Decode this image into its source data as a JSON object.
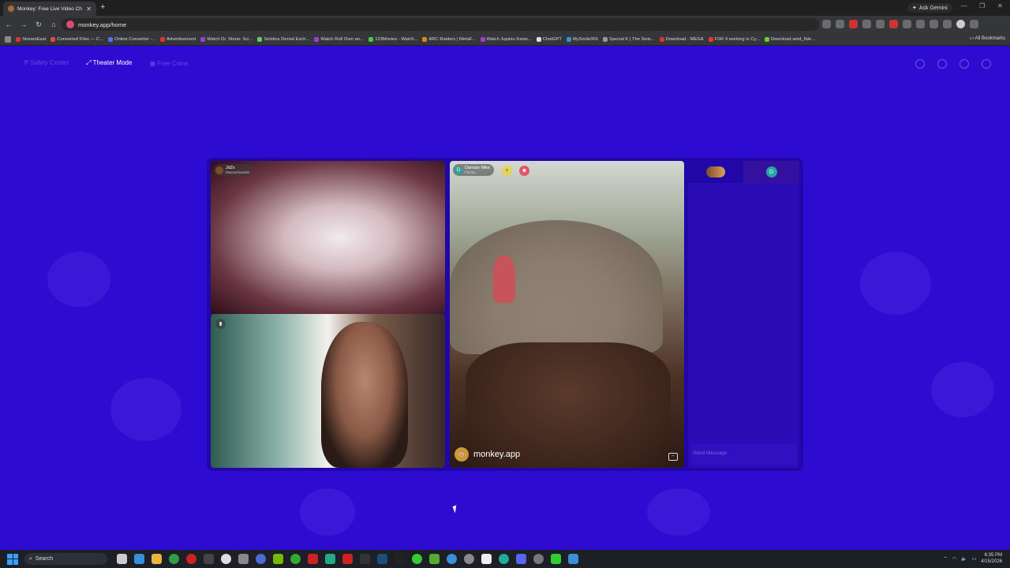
{
  "browser": {
    "tab_title": "Monkey: Free Live Video Ch",
    "url": "monkey.app/home",
    "gemini_label": "Ask Gemini",
    "all_bookmarks": "All Bookmarks",
    "bookmarks": [
      {
        "label": "StreamEast",
        "color": "#d33"
      },
      {
        "label": "Converted Files — C...",
        "color": "#e44"
      },
      {
        "label": "Online Converter -...",
        "color": "#5a6cff"
      },
      {
        "label": "Advertisement",
        "color": "#d33"
      },
      {
        "label": "Watch Dr. Stone: Sci...",
        "color": "#a33ad4"
      },
      {
        "label": "Solstice Dental Exch...",
        "color": "#6c6"
      },
      {
        "label": "Watch Roll Over an...",
        "color": "#a33ad4"
      },
      {
        "label": "123Movies - Watch...",
        "color": "#4c4"
      },
      {
        "label": "ARC Raiders | MetaF...",
        "color": "#e67e22"
      },
      {
        "label": "Watch Jujutsu Kaise...",
        "color": "#a33ad4"
      },
      {
        "label": "ChatGPT",
        "color": "#ddd"
      },
      {
        "label": "MySmile365",
        "color": "#3a8fd6"
      },
      {
        "label": "Special K | The Swis...",
        "color": "#999"
      },
      {
        "label": "Download - MEGA",
        "color": "#d33"
      },
      {
        "label": "FSR 4 working in Cy...",
        "color": "#e33"
      },
      {
        "label": "Download amd_fide...",
        "color": "#6c3"
      }
    ]
  },
  "page": {
    "nav": {
      "safety_center": "Safety Center",
      "theater_mode": "Theater Mode",
      "free_coins": "Free Coins"
    },
    "videos": {
      "top_left_user": "Jd2x",
      "top_left_location": "Massachusetts",
      "right_user": "Damian Mike",
      "right_location": "Florida",
      "watermark": "monkey.app"
    },
    "chat": {
      "tab2_initial": "D",
      "right_initial": "D",
      "placeholder": "Send Message"
    }
  },
  "taskbar": {
    "search_label": "Search",
    "time": "6:35 PM",
    "date": "4/15/2026"
  }
}
